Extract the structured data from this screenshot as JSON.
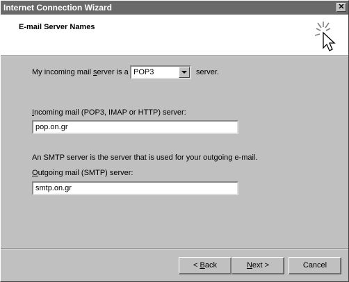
{
  "window": {
    "title": "Internet Connection Wizard",
    "close_glyph": "✕"
  },
  "header": {
    "heading": "E-mail Server Names",
    "icon": "wizard-cursor-icon"
  },
  "incoming_type": {
    "pre_label": "My incoming mail ",
    "pre_label_accel": "s",
    "pre_label_rest": "erver is a",
    "selected": "POP3",
    "post_label": "server."
  },
  "incoming_server": {
    "label_accel": "I",
    "label_rest": "ncoming mail (POP3, IMAP or HTTP) server:",
    "value": "pop.on.gr"
  },
  "smtp_note": "An SMTP server is the server that is used for your outgoing e-mail.",
  "outgoing_server": {
    "label_accel": "O",
    "label_rest": "utgoing mail (SMTP) server:",
    "value": "smtp.on.gr"
  },
  "buttons": {
    "back_prefix": "< ",
    "back_accel": "B",
    "back_rest": "ack",
    "next_accel": "N",
    "next_rest": "ext >",
    "cancel": "Cancel"
  }
}
